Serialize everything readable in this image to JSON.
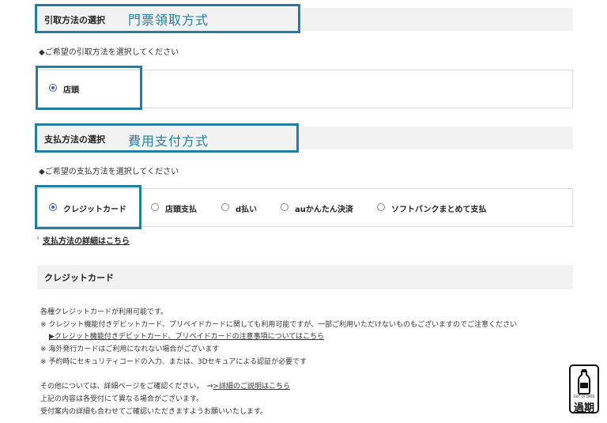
{
  "pickup": {
    "section_title": "引取方法の選択",
    "annotation": "門票領取方式",
    "prompt": "◆ご希望の引取方法を選択してください",
    "options": [
      {
        "label": "店頭",
        "selected": true
      }
    ]
  },
  "payment": {
    "section_title": "支払方法の選択",
    "annotation": "費用支付方式",
    "prompt": "◆ご希望の支払方法を選択してください",
    "options": [
      {
        "label": "クレジットカード",
        "selected": true
      },
      {
        "label": "店頭支払",
        "selected": false
      },
      {
        "label": "d払い",
        "selected": false
      },
      {
        "label": "auかんたん決済",
        "selected": false
      },
      {
        "label": "ソフトバンクまとめて支払",
        "selected": false
      }
    ],
    "details_link": "支払方法の詳細はこちら"
  },
  "credit_card": {
    "section_title": "クレジットカード",
    "line1": "各種クレジットカードが利用可能です。",
    "line2": "※ クレジット機能付きデビットカード、プリペイドカードに関しても利用可能ですが、一部ご利用いただけないものもございますのでご注意ください",
    "line3_link": "▶クレジット機能付きデビットカード、プリペイドカードの注意事項についてはこちら",
    "line4": "※ 海外発行カードはご利用になれない場合がございます",
    "line5": "※ 予約時にセキュリティコードの入力、または、3Dセキュアによる認証が必要です",
    "line6_prefix": "その他については、詳細ページをご確認ください。　⇒",
    "line6_link": ">詳細のご説明はこちら",
    "line7": "上記の内容は各受付にて異なる場合がございます。",
    "line8": "受付案内の詳細も合わせてご確認いただきますようお願いいたします。"
  },
  "badge": {
    "small_text": "OUT OF DATE",
    "text": "過期",
    "icon": "bottle-icon"
  },
  "colors": {
    "annotation": "#1f7ea1",
    "radio_selected": "#3a63c8",
    "section_bg": "#f2f2f2"
  }
}
